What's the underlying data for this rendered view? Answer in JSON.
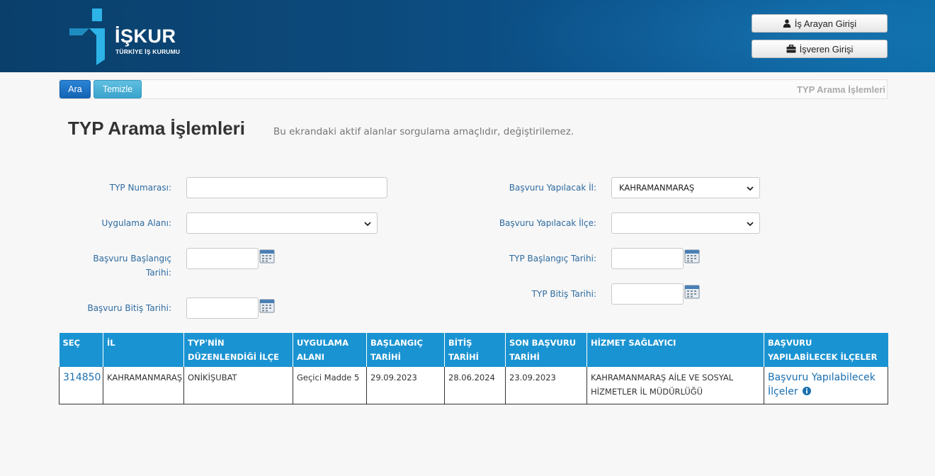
{
  "header": {
    "logo_text": "İŞKUR",
    "logo_sub": "TÜRKİYE İŞ KURUMU",
    "job_seeker_login": "İş Arayan Girişi",
    "employer_login": "İşveren Girişi",
    "colors": {
      "header_dark": "#0a3f6b",
      "header_light": "#0a6aa6"
    }
  },
  "toolbar": {
    "search_label": "Ara",
    "clear_label": "Temizle",
    "breadcrumb": "TYP Arama İşlemleri"
  },
  "page": {
    "title": "TYP Arama İşlemleri",
    "subtitle": "Bu ekrandaki aktif alanlar sorgulama amaçlıdır, değiştirilemez."
  },
  "form": {
    "typ_number_label": "TYP Numarası:",
    "typ_number_value": "",
    "application_area_label": "Uygulama Alanı:",
    "application_area_value": "",
    "app_start_date_label_1": "Başvuru Başlangıç",
    "app_start_date_label_2": "Tarihi:",
    "app_start_date_value": "",
    "app_end_date_label": "Başvuru Bitiş Tarihi:",
    "app_end_date_value": "",
    "province_label": "Başvuru Yapılacak İl:",
    "province_value": "KAHRAMANMARAŞ",
    "district_label": "Başvuru Yapılacak İlçe:",
    "district_value": "",
    "typ_start_date_label": "TYP Başlangıç Tarihi:",
    "typ_start_date_value": "",
    "typ_end_date_label": "TYP Bitiş Tarihi:",
    "typ_end_date_value": ""
  },
  "table": {
    "headers": [
      "SEÇ",
      "İL",
      "TYP'NİN DÜZENLENDİĞİ İLÇE",
      "UYGULAMA ALANI",
      "BAŞLANGIÇ TARİHİ",
      "BİTİŞ TARİHİ",
      "SON BAŞVURU TARİHİ",
      "HİZMET SAĞLAYICI",
      "BAŞVURU YAPILABİLECEK İLÇELER"
    ],
    "rows": [
      {
        "id": "314850",
        "province": "KAHRAMANMARAŞ",
        "district": "ONİKİŞUBAT",
        "area": "Geçici Madde 5",
        "start": "29.09.2023",
        "end": "28.06.2024",
        "deadline": "23.09.2023",
        "provider": "KAHRAMANMARAŞ AİLE VE SOSYAL HİZMETLER İL MÜDÜRLÜĞÜ",
        "districts_link": "Başvuru Yapılabilecek İlçeler"
      }
    ],
    "colors": {
      "header_bg": "#1a93d2",
      "link": "#1a6fb0"
    }
  }
}
